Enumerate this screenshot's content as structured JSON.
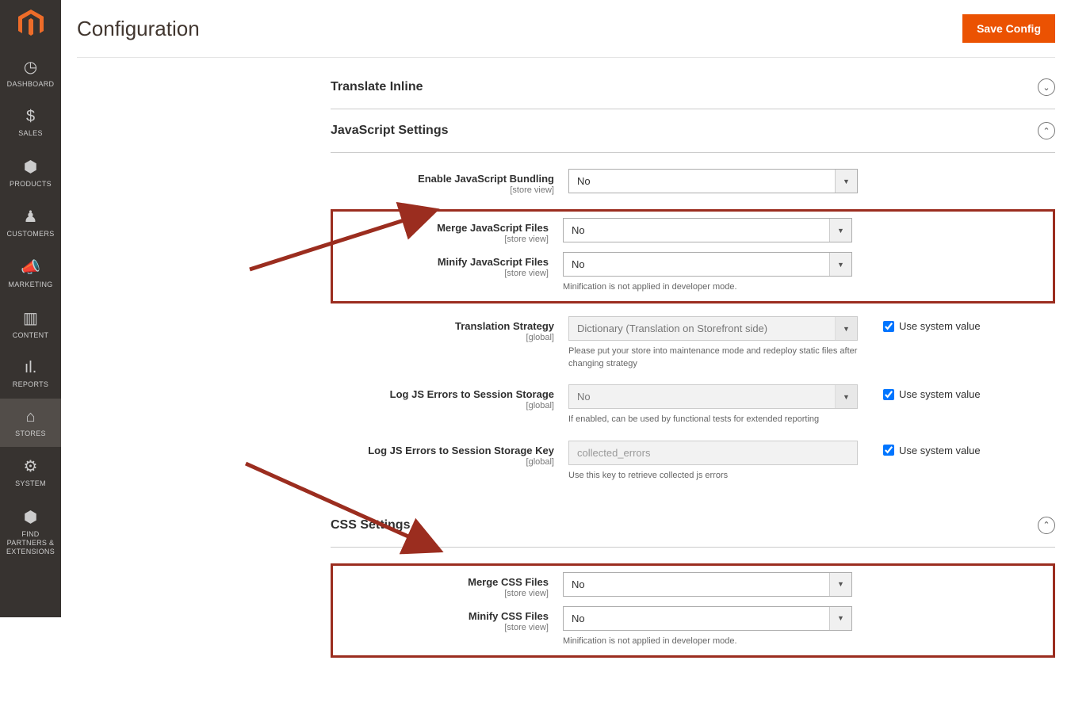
{
  "page": {
    "title": "Configuration",
    "save_button": "Save Config"
  },
  "sidebar": {
    "items": [
      {
        "label": "DASHBOARD"
      },
      {
        "label": "SALES"
      },
      {
        "label": "PRODUCTS"
      },
      {
        "label": "CUSTOMERS"
      },
      {
        "label": "MARKETING"
      },
      {
        "label": "CONTENT"
      },
      {
        "label": "REPORTS"
      },
      {
        "label": "STORES"
      },
      {
        "label": "SYSTEM"
      },
      {
        "label": "FIND PARTNERS & EXTENSIONS"
      }
    ]
  },
  "sections": {
    "translate": {
      "title": "Translate Inline"
    },
    "js": {
      "title": "JavaScript Settings",
      "fields": {
        "bundling": {
          "label": "Enable JavaScript Bundling",
          "scope": "[store view]",
          "value": "No"
        },
        "merge": {
          "label": "Merge JavaScript Files",
          "scope": "[store view]",
          "value": "No"
        },
        "minify": {
          "label": "Minify JavaScript Files",
          "scope": "[store view]",
          "value": "No",
          "help": "Minification is not applied in developer mode."
        },
        "translation": {
          "label": "Translation Strategy",
          "scope": "[global]",
          "value": "Dictionary (Translation on Storefront side)",
          "help": "Please put your store into maintenance mode and redeploy static files after changing strategy",
          "system_label": "Use system value"
        },
        "log_errors": {
          "label": "Log JS Errors to Session Storage",
          "scope": "[global]",
          "value": "No",
          "help": "If enabled, can be used by functional tests for extended reporting",
          "system_label": "Use system value"
        },
        "log_key": {
          "label": "Log JS Errors to Session Storage Key",
          "scope": "[global]",
          "value": "collected_errors",
          "help": "Use this key to retrieve collected js errors",
          "system_label": "Use system value"
        }
      }
    },
    "css": {
      "title": "CSS Settings",
      "fields": {
        "merge": {
          "label": "Merge CSS Files",
          "scope": "[store view]",
          "value": "No"
        },
        "minify": {
          "label": "Minify CSS Files",
          "scope": "[store view]",
          "value": "No",
          "help": "Minification is not applied in developer mode."
        }
      }
    }
  }
}
